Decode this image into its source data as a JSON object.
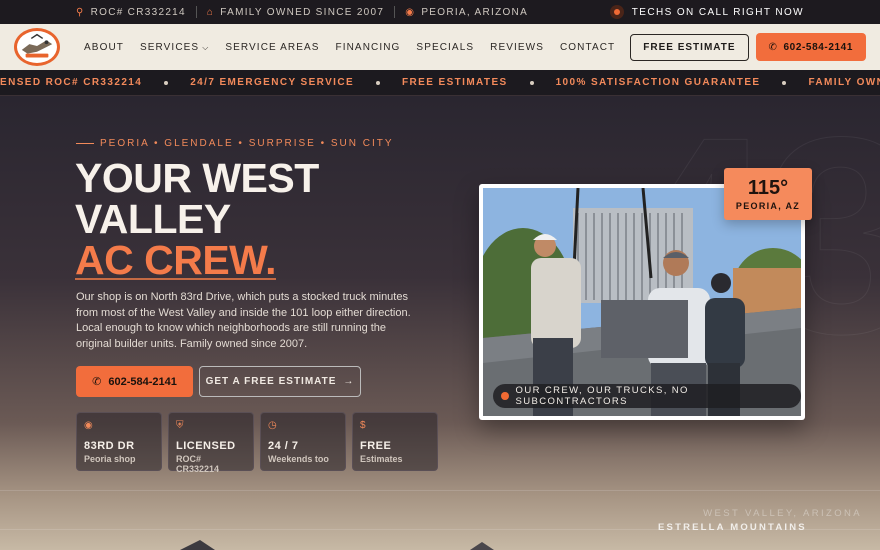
{
  "topbar": {
    "license": "ROC# CR332214",
    "family": "FAMILY OWNED SINCE 2007",
    "location": "PEORIA, ARIZONA",
    "oncall": "TECHS ON CALL RIGHT NOW"
  },
  "nav": {
    "items": [
      "ABOUT",
      "SERVICES",
      "SERVICE AREAS",
      "FINANCING",
      "SPECIALS",
      "REVIEWS",
      "CONTACT"
    ],
    "estimate_button": "FREE ESTIMATE",
    "phone_button": "602-584-2141"
  },
  "ticker": [
    "ENSED ROC# CR332214",
    "24/7 EMERGENCY SERVICE",
    "FREE ESTIMATES",
    "100% SATISFACTION GUARANTEE",
    "FAMILY OWNED SINCE 2007"
  ],
  "hero": {
    "background_number": "43",
    "eyebrow": "PEORIA • GLENDALE • SURPRISE • SUN CITY",
    "headline_line1": "YOUR WEST",
    "headline_line2": "VALLEY",
    "headline_accent": "AC CREW.",
    "paragraph": "Our shop is on North 83rd Drive, which puts a stocked truck minutes from most of the West Valley and inside the 101 loop either direction. Local enough to know which neighborhoods are still running the original builder units. Family owned since 2007.",
    "cta_phone": "602-584-2141",
    "cta_estimate": "GET A FREE ESTIMATE",
    "cards": [
      {
        "icon": "map-pin-icon",
        "title": "83RD DR",
        "sub": "Peoria shop"
      },
      {
        "icon": "shield-icon",
        "title": "LICENSED",
        "sub": "ROC# CR332214"
      },
      {
        "icon": "clock-icon",
        "title": "24 / 7",
        "sub": "Weekends too"
      },
      {
        "icon": "dollar-icon",
        "title": "FREE",
        "sub": "Estimates"
      }
    ],
    "photo_caption": "OUR CREW, OUR TRUCKS, NO SUBCONTRACTORS",
    "temp_value": "115°",
    "temp_label": "PEORIA, AZ",
    "region_label": "WEST VALLEY, ARIZONA",
    "mountain_label": "ESTRELLA MOUNTAINS"
  },
  "colors": {
    "accent": "#f26d3c",
    "dark": "#1d1a1f",
    "cream": "#f0ebe1"
  }
}
